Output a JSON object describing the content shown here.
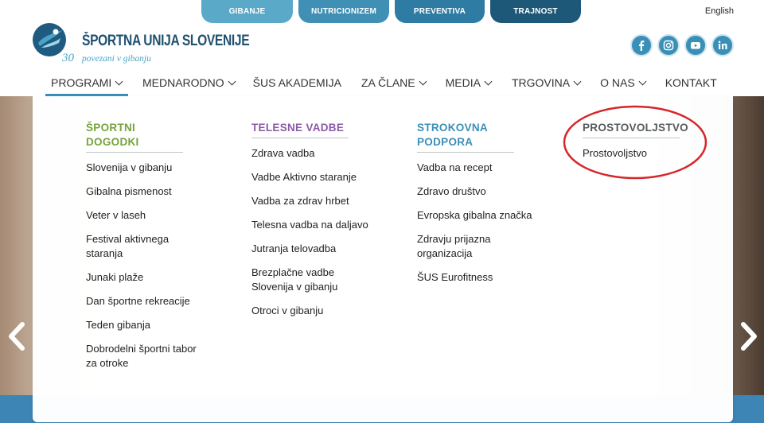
{
  "top_tabs": [
    {
      "label": "GIBANJE",
      "color": "#5aa9c9"
    },
    {
      "label": "NUTRICIONIZEM",
      "color": "#3f90b4"
    },
    {
      "label": "PREVENTIVA",
      "color": "#2e7ca3"
    },
    {
      "label": "TRAJNOST",
      "color": "#1d5878"
    }
  ],
  "language": "English",
  "logo": {
    "name": "ŠPORTNA UNIJA SLOVENIJE",
    "number": "30",
    "tagline": "povezani v gibanju"
  },
  "social": [
    "facebook-icon",
    "instagram-icon",
    "youtube-icon",
    "linkedin-icon"
  ],
  "nav": [
    {
      "label": "PROGRAMI",
      "dropdown": true
    },
    {
      "label": "MEDNARODNO",
      "dropdown": true
    },
    {
      "label": "ŠUS AKADEMIJA",
      "dropdown": false
    },
    {
      "label": "ZA ČLANE",
      "dropdown": true
    },
    {
      "label": "MEDIA",
      "dropdown": true
    },
    {
      "label": "TRGOVINA",
      "dropdown": true
    },
    {
      "label": "O NAS",
      "dropdown": true
    },
    {
      "label": "KONTAKT",
      "dropdown": false
    }
  ],
  "menu": {
    "columns": [
      {
        "title": "ŠPORTNI DOGODKI",
        "color": "#75a33a",
        "items": [
          "Slovenija v gibanju",
          "Gibalna pismenost",
          "Veter v laseh",
          "Festival aktivnega staranja",
          "Junaki plaže",
          "Dan športne rekreacije",
          "Teden gibanja",
          "Dobrodelni športni tabor za otroke"
        ]
      },
      {
        "title": "TELESNE VADBE",
        "color": "#8a5aa6",
        "items": [
          "Zdrava vadba",
          "Vadbe Aktivno staranje",
          "Vadba za zdrav hrbet",
          "Telesna vadba na daljavo",
          "Jutranja telovadba",
          "Brezplačne vadbe Slovenija v gibanju",
          "Otroci v gibanju"
        ]
      },
      {
        "title": "STROKOVNA PODPORA",
        "color": "#3a8fb7",
        "items": [
          "Vadba na recept",
          "Zdravo društvo",
          "Evropska gibalna značka",
          "Zdravju prijazna organizacija",
          "ŠUS Eurofitness"
        ]
      },
      {
        "title": "PROSTOVOLJSTVO",
        "color": "#555a5e",
        "items": [
          "Prostovoljstvo"
        ]
      }
    ]
  }
}
